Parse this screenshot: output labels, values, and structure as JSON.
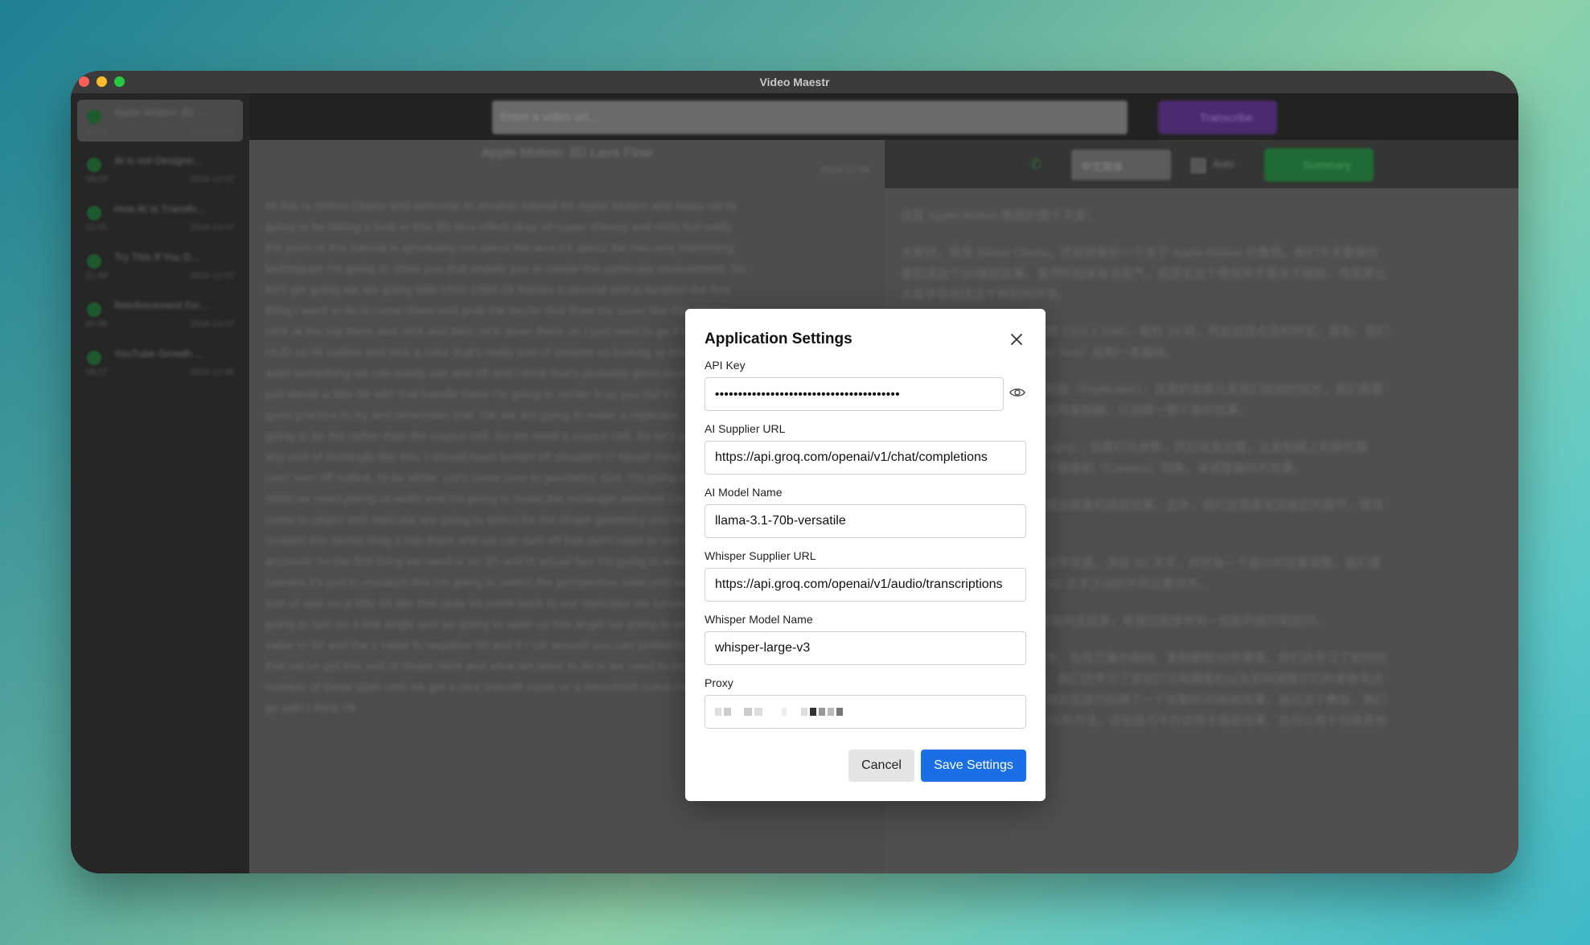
{
  "window": {
    "title": "Video Maestr"
  },
  "topbar": {
    "url_placeholder": "Enter a video url...",
    "transcribe_label": "Transcribe"
  },
  "sidebar": {
    "items": [
      {
        "title": "Apple Motion: 3D ...",
        "duration": "10:04",
        "date": "2024-12-06"
      },
      {
        "title": "AI is not Designe...",
        "duration": "08:09",
        "date": "2024-12-07"
      },
      {
        "title": "How AI Is Transfo...",
        "duration": "10:55",
        "date": "2024-12-07"
      },
      {
        "title": "Try This If You D...",
        "duration": "21:48",
        "date": "2024-12-07"
      },
      {
        "title": "Reinforcement Fin...",
        "duration": "20:38",
        "date": "2024-12-07"
      },
      {
        "title": "YouTube Growth ...",
        "duration": "08:27",
        "date": "2024-12-06"
      }
    ]
  },
  "left_pane": {
    "video_title": "Apple Motion: 3D Lava Flow",
    "date": "2024-12-06",
    "transcript": "Hi this is Simon Obelsi and welcome to another tutorial for Apple Motion and today we're going to be taking a look at this 3D lava effect okay all super cheesy and retro but really the point of this tutorial is absolutely not about the lava it's about the two very interesting techniques I'm going to show you that enable you to create this particular environment. So let's get going we are going with 1920 1080 24 frames a second and a duration the first thing I want to do is come down and grab the bezier tool draw my curve like this. We've click at the top there and click and then click down there oh I just need to go F7 for the HUD no fill outline and pick a color that's really sort of strident so looking at this we just want something we can easily see and off and I think that's probably good enough I might just tweak a little bit with that handle there I'm going to center it up you but it's always good practice to try and remember that. OK we are going to make a replicator, but it's going to be the rather than the source cell. So we need a source cell. So let's grab draw any sort of rectangle like this. I should have turned off shouldn't I? Never mind. Let's come over, turn off outline, to be white. Let's come over to geometry, size. I'm going to know 4000 we need plenty of width and I'm going to make the rectangle selected I'm going to come to object and replicate are going to select for the shape geometry and let's use the created this bezier drag it into there and we can turn off that don't need to see that anymore So the first thing we need is on 3D and in actual fact I'm going to also add a camera it's just to visualize this I'm going to switch the perspective view until we looking sort of side on a little bit like that okay let come back to our replicator we turned on 3d we going to turn on a line angle and we going to open up this angle we going to set the x value to 90 and the z value to negative 90 and if I cut around you can probably see now that we've got this sort of shape here and what we need to do is we need to increase the number of these slats until we get a nice smooth curve or a smoothish curve I'm going to go with I think 78"
  },
  "right_pane": {
    "language": "中文简体",
    "auto_label": "Auto",
    "summary_label": "Summary",
    "summary_paragraphs": [
      "这是 Apple Motion 教程的整个文章：",
      "大家好，我是 Simon Obelsi，欢迎观看另一个关于 Apple Motion 的教程。我们今天要做的是创造这个3D熔岩效果，虽然听起来有点俗气，但其实这个教程并不是关于熔岩，而是要让大家学会创造这个特别的环境。",
      "我们开始吧，首先，我们要用 1920 x 1080，每秒 24 帧，然后选择合适的时长。首先，我们需要使用贝塞尔工具（Bezier Tool）绘制一条曲线。",
      "接下来，我们要制作一个复制器（Replicator），这里的源单元是我们绘制的矩形，我们需要调整矩形的宽度和高度，然后用复制器，以创建一整个面的效果。",
      "然后我们要添加一个灯光（Light），设置灯光参数，然后将其设置，让复制器上的颜色跟随，然后，我们需要添加一个摄像机（Camera）视角，来调整最终的效果。",
      "通过这些步骤，我们可以创建出精美的熔岩效果。此外，我们还需要添加最后的细节，使效果更加逼真。",
      "最后，我们需要再添加一些文字效果，添加 3D 文字，并将每一个部分的效果调整。我们需要把文字变成 3D 文字并与 3D 文字之间的不同位置对齐。",
      "我们今天的 Apple Motion 教程到此结束，希望您能够学到一些新的技巧和知识。",
      "通过这个教程我们学到了很多，包括贝塞尔曲线、复制器和3D效果等。我们还学习了如何创建出一个完整的场景，此外，我们还学习了添加灯光和摄像机以及如何调整它们的参数来达到理想的效果。最后，我们用这些技巧创建了一个完整的3D熔岩效果，通过这个教程，我们掌握了很多制作3D动画的技巧和方法，这些技巧不仅适用于熔岩效果，也可以用于创建其他类型的3D场景。"
    ]
  },
  "modal": {
    "title": "Application Settings",
    "fields": {
      "api_key": {
        "label": "API Key",
        "value": "••••••••••••••••••••••••••••••••••••••••"
      },
      "ai_supplier_url": {
        "label": "AI Supplier URL",
        "value": "https://api.groq.com/openai/v1/chat/completions"
      },
      "ai_model_name": {
        "label": "AI Model Name",
        "value": "llama-3.1-70b-versatile"
      },
      "whisper_supplier_url": {
        "label": "Whisper Supplier URL",
        "value": "https://api.groq.com/openai/v1/audio/transcriptions"
      },
      "whisper_model_name": {
        "label": "Whisper Model Name",
        "value": "whisper-large-v3"
      },
      "proxy": {
        "label": "Proxy"
      }
    },
    "cancel_label": "Cancel",
    "save_label": "Save Settings"
  }
}
